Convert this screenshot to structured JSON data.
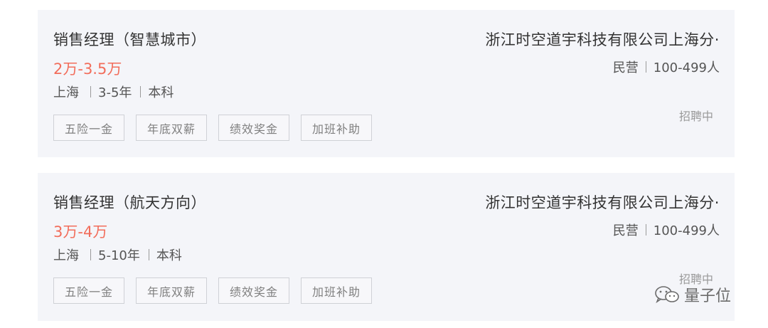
{
  "jobs": [
    {
      "title": "销售经理（智慧城市）",
      "salary": "2万-3.5万",
      "city": "上海",
      "experience": "3-5年",
      "education": "本科",
      "tags": [
        "五险一金",
        "年底双薪",
        "绩效奖金",
        "加班补助"
      ],
      "company": "浙江时空道宇科技有限公司上海分·",
      "company_type": "民营",
      "company_size": "100-499人",
      "status": "招聘中"
    },
    {
      "title": "销售经理（航天方向）",
      "salary": "3万-4万",
      "city": "上海",
      "experience": "5-10年",
      "education": "本科",
      "tags": [
        "五险一金",
        "年底双薪",
        "绩效奖金",
        "加班补助"
      ],
      "company": "浙江时空道宇科技有限公司上海分·",
      "company_type": "民营",
      "company_size": "100-499人",
      "status": "招聘中"
    }
  ],
  "watermark": {
    "text": "量子位",
    "icon": "wechat-icon"
  },
  "colors": {
    "salary": "#f26d5b",
    "card_bg": "#f4f5f9",
    "tag_border": "#cfd1d6"
  }
}
